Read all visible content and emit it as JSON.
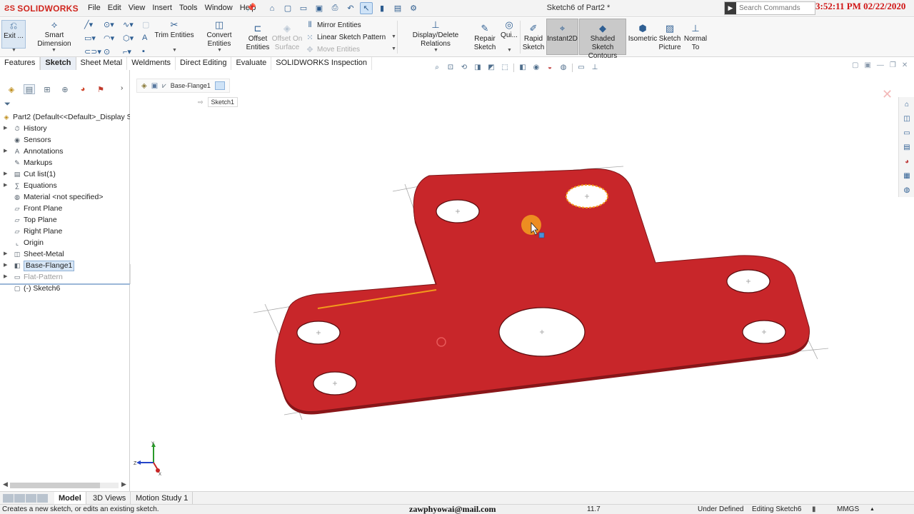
{
  "app": {
    "brand": "SOLIDWORKS",
    "menu": [
      "File",
      "Edit",
      "View",
      "Insert",
      "Tools",
      "Window",
      "Help"
    ],
    "document_title": "Sketch6 of Part2 *",
    "search_placeholder": "Search Commands",
    "clock_overlay": "3:52:11 PM 02/22/2020"
  },
  "ribbon": {
    "exit_label": "Exit ...",
    "smart_dimension": "Smart Dimension",
    "trim_entities": "Trim Entities",
    "convert_entities": "Convert Entities",
    "offset_entities": [
      "Offset",
      "Entities"
    ],
    "offset_on_surface": [
      "Offset On",
      "Surface"
    ],
    "mirror_entities": "Mirror Entities",
    "linear_sketch_pattern": "Linear Sketch Pattern",
    "move_entities": "Move Entities",
    "display_delete_relations": "Display/Delete Relations",
    "repair_sketch": [
      "Repair",
      "Sketch"
    ],
    "quick_snaps": "Qui...",
    "rapid_sketch": [
      "Rapid",
      "Sketch"
    ],
    "instant2d": "Instant2D",
    "shaded_sketch_contours": [
      "Shaded Sketch",
      "Contours"
    ],
    "isometric": "Isometric",
    "sketch_picture": [
      "Sketch",
      "Picture"
    ],
    "normal_to": [
      "Normal",
      "To"
    ]
  },
  "tabs": [
    {
      "label": "Features",
      "active": false
    },
    {
      "label": "Sketch",
      "active": true
    },
    {
      "label": "Sheet Metal",
      "active": false
    },
    {
      "label": "Weldments",
      "active": false
    },
    {
      "label": "Direct Editing",
      "active": false
    },
    {
      "label": "Evaluate",
      "active": false
    },
    {
      "label": "SOLIDWORKS Inspection",
      "active": false
    }
  ],
  "feature_tree": {
    "root": "Part2  (Default<<Default>_Display S",
    "items": [
      {
        "label": "History",
        "icon": "history-icon",
        "expandable": true
      },
      {
        "label": "Sensors",
        "icon": "sensor-icon",
        "expandable": false
      },
      {
        "label": "Annotations",
        "icon": "annotation-icon",
        "expandable": true
      },
      {
        "label": "Markups",
        "icon": "markup-icon",
        "expandable": false
      },
      {
        "label": "Cut list(1)",
        "icon": "cut-list-icon",
        "expandable": true
      },
      {
        "label": "Equations",
        "icon": "equation-icon",
        "expandable": true
      },
      {
        "label": "Material <not specified>",
        "icon": "material-icon",
        "expandable": false
      },
      {
        "label": "Front Plane",
        "icon": "plane-icon",
        "expandable": false
      },
      {
        "label": "Top Plane",
        "icon": "plane-icon",
        "expandable": false
      },
      {
        "label": "Right Plane",
        "icon": "plane-icon",
        "expandable": false
      },
      {
        "label": "Origin",
        "icon": "origin-icon",
        "expandable": false
      },
      {
        "label": "Sheet-Metal",
        "icon": "sheet-metal-icon",
        "expandable": true
      },
      {
        "label": "Base-Flange1",
        "icon": "base-flange-icon",
        "expandable": true,
        "selected": true
      },
      {
        "label": "Flat-Pattern",
        "icon": "flat-pattern-icon",
        "expandable": true,
        "greyed": true
      },
      {
        "label": "(-) Sketch6",
        "icon": "sketch-icon",
        "expandable": false
      }
    ]
  },
  "viewport": {
    "breadcrumb": "Base-Flange1",
    "sub_breadcrumb": "Sketch1",
    "part_color": "#c8262a",
    "sketch_highlight_color": "#f39a1c"
  },
  "bottom_tabs": [
    {
      "label": "Model",
      "active": true
    },
    {
      "label": "3D Views",
      "active": false
    },
    {
      "label": "Motion Study 1",
      "active": false
    }
  ],
  "status": {
    "hint": "Creates a new sketch, or edits an existing sketch.",
    "email": "zawphyowai@mail.com",
    "value": "11.7",
    "state": "Under Defined",
    "mode": "Editing Sketch6",
    "units": "MMGS"
  }
}
